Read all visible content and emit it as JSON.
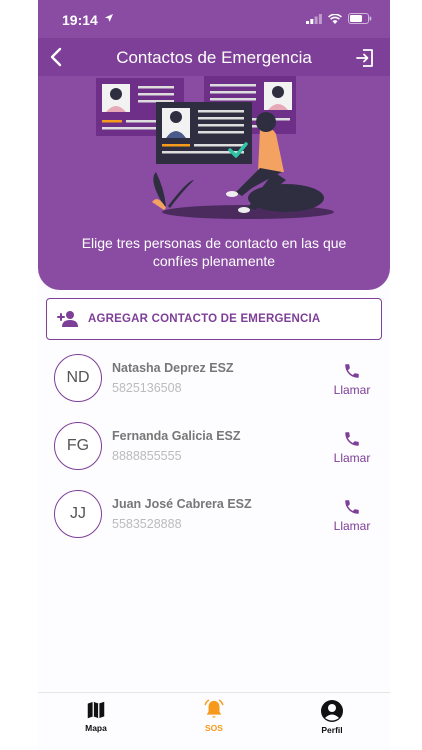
{
  "status": {
    "time": "19:14"
  },
  "nav": {
    "title": "Contactos de Emergencia"
  },
  "header": {
    "message": "Elige tres personas de contacto en las que confíes plenamente"
  },
  "add_button": {
    "label": "AGREGAR CONTACTO DE EMERGENCIA"
  },
  "contacts": [
    {
      "initials": "ND",
      "name": "Natasha Deprez ESZ",
      "phone": "5825136508",
      "call_label": "Llamar"
    },
    {
      "initials": "FG",
      "name": "Fernanda Galicia ESZ",
      "phone": "8888855555",
      "call_label": "Llamar"
    },
    {
      "initials": "JJ",
      "name": "Juan José Cabrera ESZ",
      "phone": "5583528888",
      "call_label": "Llamar"
    }
  ],
  "tabs": [
    {
      "label": "Mapa",
      "icon": "map-icon",
      "active": false
    },
    {
      "label": "SOS",
      "icon": "bell-icon",
      "active": true
    },
    {
      "label": "Perfil",
      "icon": "account-circle-icon",
      "active": false
    }
  ],
  "colors": {
    "primary": "#7d3f97",
    "header_bg": "#8a4ca3",
    "accent": "#f59a1b",
    "check": "#2ec4a6"
  }
}
